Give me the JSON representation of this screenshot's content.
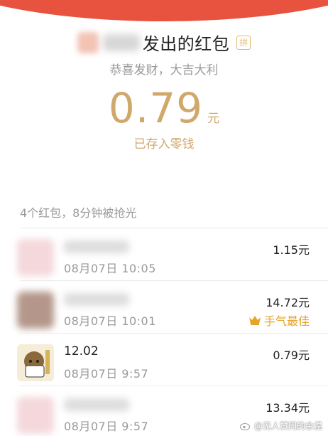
{
  "header": {
    "title": "发出的红包",
    "pin_icon_text": "拼",
    "greeting": "恭喜发财，大吉大利"
  },
  "amount": {
    "value": "0.79",
    "unit": "元",
    "saved_text": "已存入零钱"
  },
  "summary": "4个红包，8分钟被抢光",
  "records": [
    {
      "name": "",
      "time": "08月07日 10:05",
      "amount": "1.15元",
      "best": ""
    },
    {
      "name": "",
      "time": "08月07日 10:01",
      "amount": "14.72元",
      "best": "手气最佳"
    },
    {
      "name": "12.02",
      "time": "08月07日  9:57",
      "amount": "0.79元",
      "best": ""
    },
    {
      "name": "",
      "time": "08月07日  9:57",
      "amount": "13.34元",
      "best": ""
    }
  ],
  "watermark": "@无人赞同的余温",
  "colors": {
    "header_red": "#e8533f",
    "gold": "#d0a86b",
    "best": "#e6a428"
  },
  "icons": {
    "pin": "pin-icon",
    "crown": "crown-icon",
    "weibo": "weibo-icon"
  }
}
